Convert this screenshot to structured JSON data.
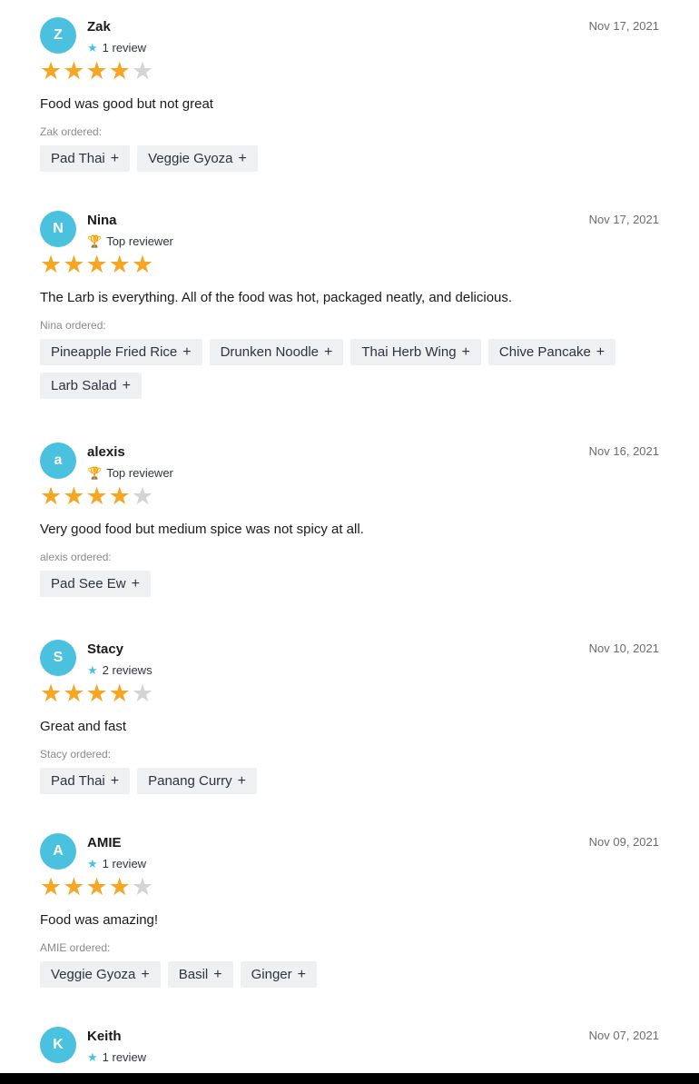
{
  "reviews": [
    {
      "initial": "Z",
      "name": "Zak",
      "badge_type": "count",
      "badge_text": "1 review",
      "date": "Nov 17, 2021",
      "rating": 4,
      "text": "Food was good but not great",
      "ordered_label": "Zak ordered:",
      "dishes": [
        "Pad Thai",
        "Veggie Gyoza"
      ]
    },
    {
      "initial": "N",
      "name": "Nina",
      "badge_type": "top",
      "badge_text": "Top reviewer",
      "date": "Nov 17, 2021",
      "rating": 5,
      "text": "The Larb is everything. All of the food was hot, packaged neatly, and delicious.",
      "ordered_label": "Nina ordered:",
      "dishes": [
        "Pineapple Fried Rice",
        "Drunken Noodle",
        "Thai Herb Wing",
        "Chive Pancake",
        "Larb Salad"
      ]
    },
    {
      "initial": "a",
      "name": "alexis",
      "badge_type": "top",
      "badge_text": "Top reviewer",
      "date": "Nov 16, 2021",
      "rating": 4,
      "text": "Very good food but medium spice was not spicy at all.",
      "ordered_label": "alexis ordered:",
      "dishes": [
        "Pad See Ew"
      ]
    },
    {
      "initial": "S",
      "name": "Stacy",
      "badge_type": "count",
      "badge_text": "2 reviews",
      "date": "Nov 10, 2021",
      "rating": 4,
      "text": "Great and fast",
      "ordered_label": "Stacy ordered:",
      "dishes": [
        "Pad Thai",
        "Panang Curry"
      ]
    },
    {
      "initial": "A",
      "name": "AMIE",
      "badge_type": "count",
      "badge_text": "1 review",
      "date": "Nov 09, 2021",
      "rating": 4,
      "text": "Food was amazing!",
      "ordered_label": "AMIE ordered:",
      "dishes": [
        "Veggie Gyoza",
        "Basil",
        "Ginger"
      ]
    },
    {
      "initial": "K",
      "name": "Keith",
      "badge_type": "count",
      "badge_text": "1 review",
      "date": "Nov 07, 2021",
      "rating": null,
      "text": "",
      "ordered_label": "",
      "dishes": []
    }
  ],
  "icons": {
    "plus": "+",
    "rating_star": "★",
    "badge_star": "★",
    "trophy": "🏆"
  },
  "colors": {
    "avatar": "#4ac1df",
    "star_on": "#f6a623",
    "star_off": "#d4d4d4"
  }
}
